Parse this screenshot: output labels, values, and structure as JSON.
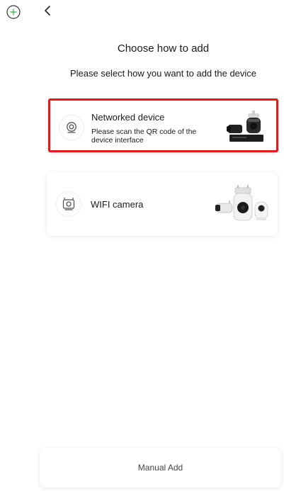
{
  "header": {
    "add_icon": "plus-circle-icon",
    "back_icon": "chevron-left-icon",
    "title": "Choose how to add",
    "subtitle": "Please select how you want to add the device"
  },
  "options": [
    {
      "title": "Networked device",
      "description": "Please scan the QR code of the device interface",
      "icon": "webcam-icon",
      "image": "network-cameras-image",
      "highlight_color": "#e3191b"
    },
    {
      "title": "WIFI camera",
      "icon": "wifi-camera-icon",
      "image": "wifi-cameras-image"
    }
  ],
  "footer": {
    "manual_add_label": "Manual Add"
  },
  "colors": {
    "add_icon": "#3cb043",
    "highlight": "#e3191b"
  }
}
